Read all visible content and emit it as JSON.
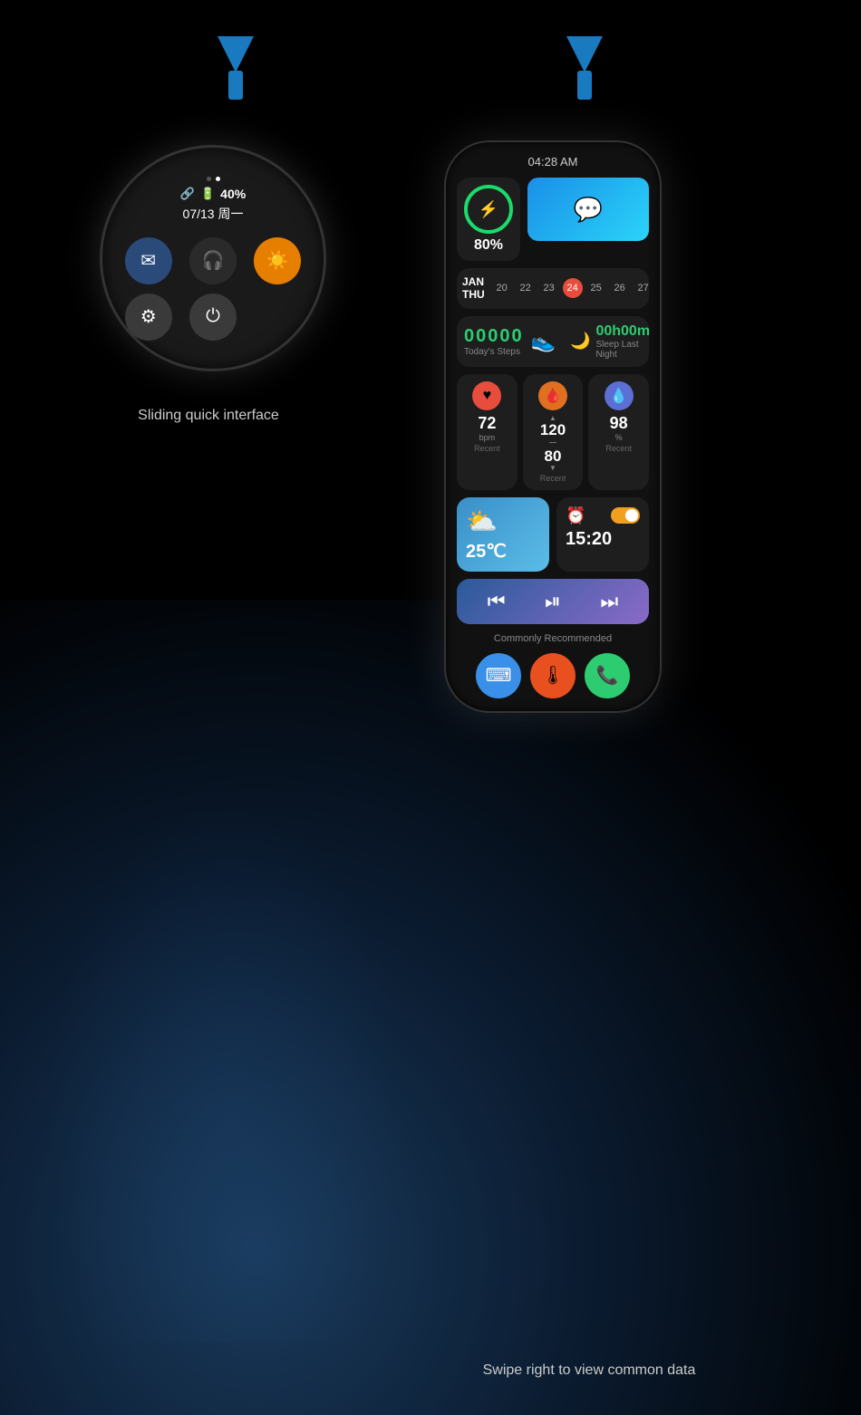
{
  "arrows": {
    "left_label": "arrow-down-left",
    "right_label": "arrow-down-right",
    "color": "#1a7abf"
  },
  "round_watch": {
    "dots": [
      false,
      true
    ],
    "link_icon": "🔗",
    "battery_percent": "40%",
    "date": "07/13 周一",
    "icons": [
      {
        "id": "mail",
        "symbol": "✉",
        "class": "wi-mail"
      },
      {
        "id": "bluetooth",
        "symbol": "🎧",
        "class": "wi-bluetooth"
      },
      {
        "id": "brightness",
        "symbol": "☀",
        "class": "wi-brightness"
      },
      {
        "id": "settings",
        "symbol": "⚙",
        "class": "wi-settings"
      },
      {
        "id": "power",
        "symbol": "⏻",
        "class": "wi-power"
      }
    ],
    "label": "Sliding quick interface"
  },
  "band": {
    "time": "04:28 AM",
    "charging_pct": "80%",
    "calendar": {
      "month": "JAN",
      "day": "THU",
      "dates": [
        {
          "num": "20",
          "today": false
        },
        {
          "num": "22",
          "today": false
        },
        {
          "num": "23",
          "today": false
        },
        {
          "num": "24",
          "today": true
        },
        {
          "num": "25",
          "today": false
        },
        {
          "num": "26",
          "today": false
        },
        {
          "num": "27",
          "today": false
        }
      ]
    },
    "steps": {
      "value": "00000",
      "label": "Today's Steps"
    },
    "sleep": {
      "value": "00h00m",
      "label": "Sleep Last Night"
    },
    "metrics": [
      {
        "id": "heart",
        "value": "72",
        "unit": "bpm",
        "sub": "",
        "label": "Recent",
        "class": "mi-heart",
        "symbol": "♥"
      },
      {
        "id": "bp",
        "value_top": "120",
        "value_bot": "80",
        "label": "Recent",
        "class": "mi-bp",
        "symbol": "🩸"
      },
      {
        "id": "spo2",
        "value": "98",
        "unit": "%",
        "label": "Recent",
        "class": "mi-spo2",
        "symbol": "💧"
      }
    ],
    "weather": {
      "icon": "⛅",
      "temp": "25℃"
    },
    "alarm": {
      "time": "15:20"
    },
    "recommended_label": "Commonly Recommended",
    "apps": [
      {
        "id": "keyboard",
        "symbol": "⌨",
        "class": "app-keyboard"
      },
      {
        "id": "health",
        "symbol": "🌡",
        "class": "app-health"
      },
      {
        "id": "phone",
        "symbol": "📞",
        "class": "app-phone"
      }
    ]
  },
  "caption": "Swipe right to view common data"
}
